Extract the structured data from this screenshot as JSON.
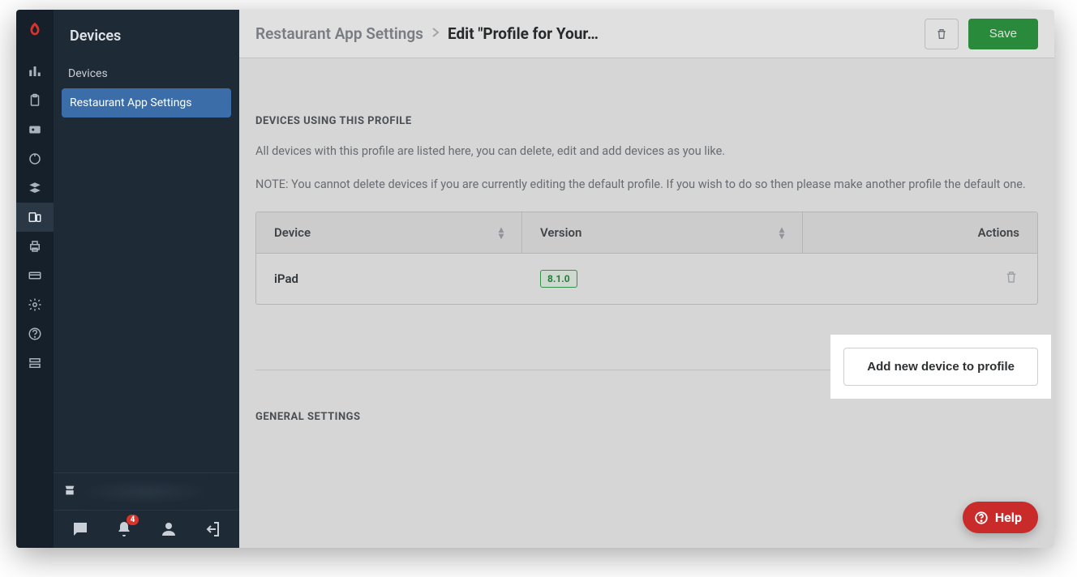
{
  "subnav": {
    "title": "Devices",
    "items": [
      {
        "label": "Devices"
      },
      {
        "label": "Restaurant App Settings"
      }
    ]
  },
  "breadcrumb": {
    "parent": "Restaurant App Settings",
    "current": "Edit \"Profile for Your…"
  },
  "topbar": {
    "save_label": "Save"
  },
  "section": {
    "heading": "DEVICES USING THIS PROFILE",
    "desc1": "All devices with this profile are listed here, you can delete, edit and add devices as you like.",
    "desc2": "NOTE: You cannot delete devices if you are currently editing the default profile. If you wish to do so then please make another profile the default one."
  },
  "table": {
    "headers": {
      "device": "Device",
      "version": "Version",
      "actions": "Actions"
    },
    "rows": [
      {
        "device": "iPad",
        "version": "8.1.0"
      }
    ]
  },
  "add_button_label": "Add new device to profile",
  "general_heading": "GENERAL SETTINGS",
  "notifications_count": "4",
  "help_label": "Help"
}
